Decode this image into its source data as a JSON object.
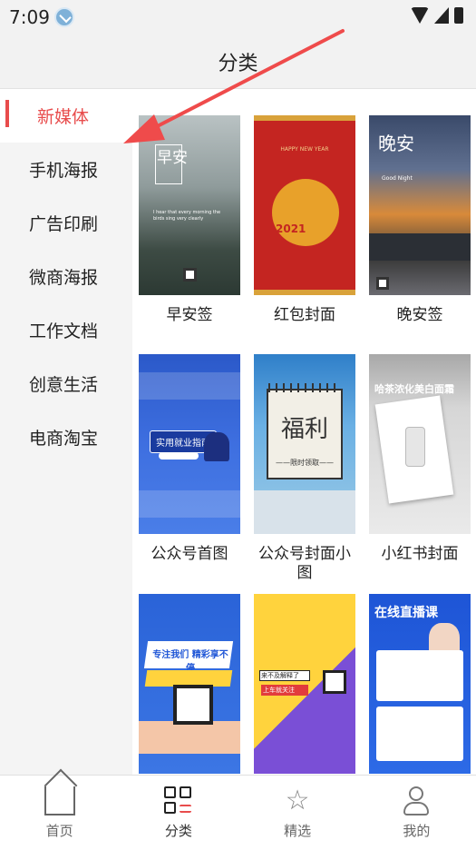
{
  "status_bar": {
    "time": "7:09"
  },
  "header": {
    "title": "分类"
  },
  "sidebar": {
    "items": [
      {
        "label": "新媒体",
        "active": true
      },
      {
        "label": "手机海报",
        "active": false
      },
      {
        "label": "广告印刷",
        "active": false
      },
      {
        "label": "微商海报",
        "active": false
      },
      {
        "label": "工作文档",
        "active": false
      },
      {
        "label": "创意生活",
        "active": false
      },
      {
        "label": "电商淘宝",
        "active": false
      }
    ]
  },
  "grid": {
    "tiles": [
      {
        "label": "早安签",
        "thumb": {
          "big": "早安",
          "subtitle": "I hear that every morning the birds sing very clearly"
        }
      },
      {
        "label": "红包封面",
        "thumb": {
          "caption": "HAPPY NEW YEAR",
          "year": "2021"
        }
      },
      {
        "label": "晚安签",
        "thumb": {
          "big": "晚安",
          "small": "Good Night"
        }
      },
      {
        "label": "公众号首图",
        "thumb": {
          "title": "实用就业指南"
        }
      },
      {
        "label": "公众号封面小图",
        "thumb": {
          "word": "福利",
          "caption": "——限时领取——"
        }
      },
      {
        "label": "小红书封面",
        "thumb": {
          "headline": "哈茶浓化美白面霜"
        }
      },
      {
        "label": "",
        "thumb": {
          "headline": "专注我们 精彩享不停"
        }
      },
      {
        "label": "",
        "thumb": {
          "line1": "来不及解释了",
          "line2": "上车就关注"
        }
      },
      {
        "label": "",
        "thumb": {
          "headline": "在线直播课"
        }
      }
    ]
  },
  "tabbar": {
    "items": [
      {
        "label": "首页",
        "icon": "home-icon",
        "active": false
      },
      {
        "label": "分类",
        "icon": "category-icon",
        "active": true
      },
      {
        "label": "精选",
        "icon": "star-icon",
        "active": false
      },
      {
        "label": "我的",
        "icon": "user-icon",
        "active": false
      }
    ]
  },
  "colors": {
    "accent": "#e84c4c",
    "annotation_arrow": "#ef4b4b"
  }
}
